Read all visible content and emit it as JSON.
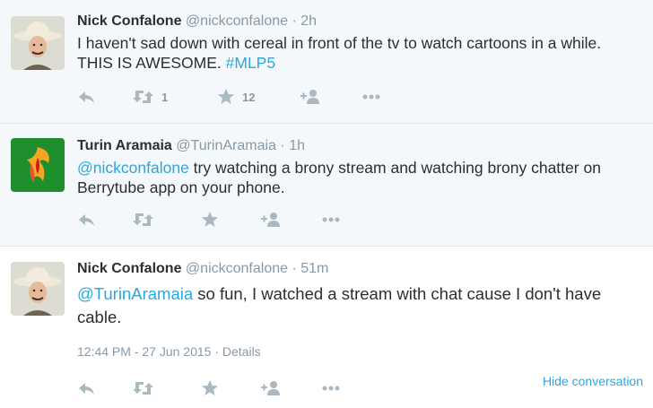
{
  "colors": {
    "link": "#2ba7e0",
    "muted": "#8899a6",
    "text": "#292f33",
    "bg_alt": "#f5f8fa"
  },
  "tweets": [
    {
      "name": "Nick Confalone",
      "handle": "@nickconfalone",
      "time": "2h",
      "text_parts": [
        "I haven't sad down with cereal in front of the tv to watch cartoons in a while. THIS IS AWESOME. ",
        "#MLP5"
      ],
      "retweets": "1",
      "favorites": "12",
      "avatar": "cowboy-hat-man"
    },
    {
      "name": "Turin Aramaia",
      "handle": "@TurinAramaia",
      "time": "1h",
      "text_parts": [
        "@nickconfalone",
        " try watching a brony stream and watching brony chatter on Berrytube app on your phone."
      ],
      "avatar": "phoenix-logo"
    },
    {
      "name": "Nick Confalone",
      "handle": "@nickconfalone",
      "time": "51m",
      "text_parts": [
        "@TurinAramaia",
        " so fun, I watched a stream with chat cause I don't have cable."
      ],
      "timestamp": "12:44 PM - 27 Jun 2015",
      "details": "Details",
      "hide": "Hide conversation",
      "avatar": "cowboy-hat-man"
    }
  ],
  "icons": [
    "reply-icon",
    "retweet-icon",
    "favorite-icon",
    "follow-icon",
    "more-icon"
  ],
  "separator": "·"
}
